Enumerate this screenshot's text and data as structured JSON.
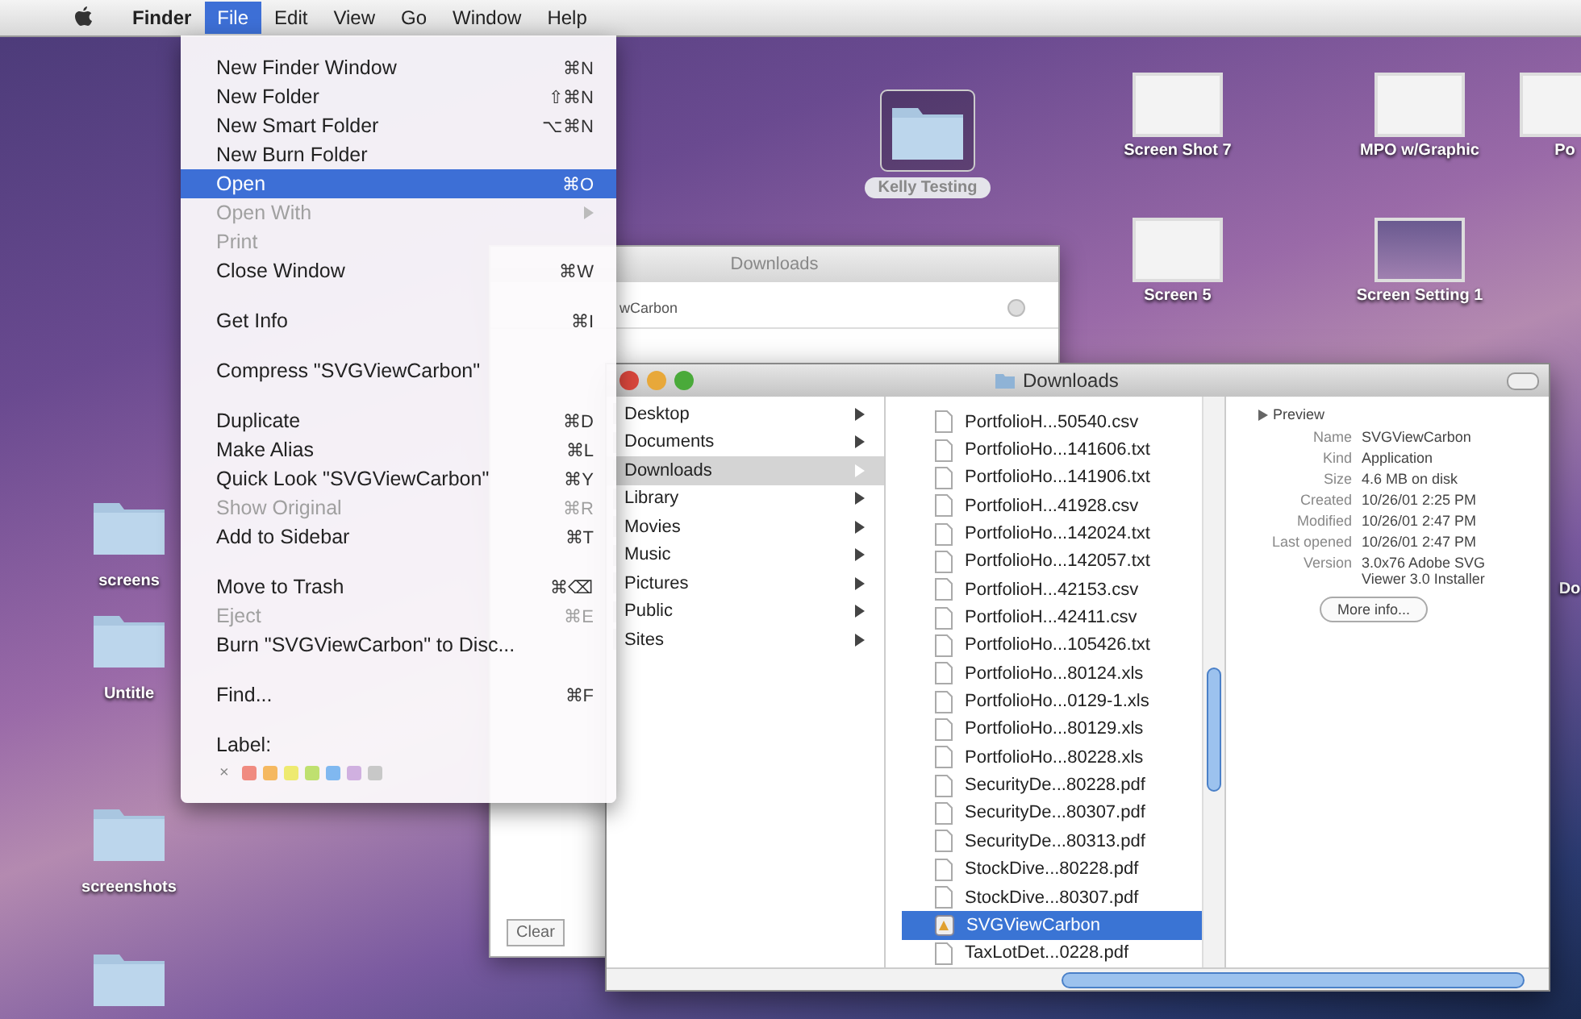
{
  "menu_bar": {
    "items": [
      {
        "label": "Finder",
        "selected": false
      },
      {
        "label": "File",
        "selected": true
      },
      {
        "label": "Edit",
        "selected": false
      },
      {
        "label": "View",
        "selected": false
      },
      {
        "label": "Go",
        "selected": false
      },
      {
        "label": "Window",
        "selected": false
      },
      {
        "label": "Help",
        "selected": false
      }
    ]
  },
  "desktop_icons": [
    {
      "label": "Kelly Testing",
      "kind": "folder",
      "selected": true
    },
    {
      "label": "Screen Shot 7",
      "kind": "screenshot",
      "selected": false
    },
    {
      "label": "MPO w/Graphic",
      "kind": "screenshot",
      "selected": false
    },
    {
      "label": "Po",
      "kind": "screenshot",
      "selected": false
    },
    {
      "label": "Screen 5",
      "kind": "screenshot",
      "selected": false
    },
    {
      "label": "Screen Setting 1",
      "kind": "photo",
      "selected": false
    },
    {
      "label": "Do"
    },
    {
      "label": "screens",
      "kind": "folder",
      "selected": false
    },
    {
      "label": "Untitle",
      "kind": "folder",
      "selected": false
    },
    {
      "label": "screenshots",
      "kind": "folder",
      "selected": false
    },
    {
      "kind": "folder",
      "selected": false
    }
  ],
  "back_window": {
    "title": "Downloads",
    "item": "wCarbon",
    "button": "Clear"
  },
  "file_menu": {
    "sections": [
      {
        "items": [
          {
            "label": "New Finder Window",
            "shortcut": "⌘N",
            "disabled": false,
            "selected": false
          },
          {
            "label": "New Folder",
            "shortcut": "⇧⌘N",
            "disabled": false,
            "selected": false
          },
          {
            "label": "New Smart Folder",
            "shortcut": "⌥⌘N",
            "disabled": false,
            "selected": false
          },
          {
            "label": "New Burn Folder",
            "disabled": false,
            "selected": false
          },
          {
            "label": "Open",
            "shortcut": "⌘O",
            "disabled": false,
            "selected": true
          },
          {
            "label": "Open With",
            "disabled": true,
            "selected": false,
            "submenu": true
          },
          {
            "label": "Print",
            "disabled": true,
            "selected": false
          },
          {
            "label": "Close Window",
            "shortcut": "⌘W",
            "disabled": false,
            "selected": false
          }
        ]
      },
      {
        "items": [
          {
            "label": "Get Info",
            "shortcut": "⌘I",
            "disabled": false,
            "selected": false
          }
        ]
      },
      {
        "items": [
          {
            "label": "Compress \"SVGViewCarbon\"",
            "disabled": false,
            "selected": false
          }
        ]
      },
      {
        "items": [
          {
            "label": "Duplicate",
            "shortcut": "⌘D",
            "disabled": false,
            "selected": false
          },
          {
            "label": "Make Alias",
            "shortcut": "⌘L",
            "disabled": false,
            "selected": false
          },
          {
            "label": "Quick Look \"SVGViewCarbon\"",
            "shortcut": "⌘Y",
            "disabled": false,
            "selected": false
          },
          {
            "label": "Show Original",
            "shortcut": "⌘R",
            "disabled": true,
            "selected": false
          },
          {
            "label": "Add to Sidebar",
            "shortcut": "⌘T",
            "disabled": false,
            "selected": false
          }
        ]
      },
      {
        "items": [
          {
            "label": "Move to Trash",
            "shortcut": "⌘⌫",
            "disabled": false,
            "selected": false
          },
          {
            "label": "Eject",
            "shortcut": "⌘E",
            "disabled": true,
            "selected": false
          },
          {
            "label": "Burn \"SVGViewCarbon\" to Disc...",
            "disabled": false,
            "selected": false
          }
        ]
      },
      {
        "items": [
          {
            "label": "Find...",
            "shortcut": "⌘F",
            "disabled": false,
            "selected": false
          }
        ]
      },
      {
        "items": [
          {
            "label": "Label:",
            "disabled": false,
            "selected": false
          }
        ]
      }
    ],
    "label_none": "×",
    "label_colors": [
      {
        "color": "#f08a80"
      },
      {
        "color": "#f5b860"
      },
      {
        "color": "#eeea70"
      },
      {
        "color": "#bfe070"
      },
      {
        "color": "#80b8f0"
      },
      {
        "color": "#d0b0e0"
      },
      {
        "color": "#c8c8c8"
      }
    ]
  },
  "finder_window": {
    "title": "Downloads",
    "places": [
      {
        "label": "Desktop",
        "selected": false
      },
      {
        "label": "Documents",
        "selected": false
      },
      {
        "label": "Downloads",
        "selected": true
      },
      {
        "label": "Library",
        "selected": false
      },
      {
        "label": "Movies",
        "selected": false
      },
      {
        "label": "Music",
        "selected": false
      },
      {
        "label": "Pictures",
        "selected": false
      },
      {
        "label": "Public",
        "selected": false
      },
      {
        "label": "Sites",
        "selected": false
      }
    ],
    "files": [
      {
        "name": "PortfolioH...50540.csv",
        "kind": "document",
        "selected": false
      },
      {
        "name": "PortfolioHo...141606.txt",
        "kind": "document",
        "selected": false
      },
      {
        "name": "PortfolioHo...141906.txt",
        "kind": "document",
        "selected": false
      },
      {
        "name": "PortfolioH...41928.csv",
        "kind": "document",
        "selected": false
      },
      {
        "name": "PortfolioHo...142024.txt",
        "kind": "document",
        "selected": false
      },
      {
        "name": "PortfolioHo...142057.txt",
        "kind": "document",
        "selected": false
      },
      {
        "name": "PortfolioH...42153.csv",
        "kind": "document",
        "selected": false
      },
      {
        "name": "PortfolioH...42411.csv",
        "kind": "document",
        "selected": false
      },
      {
        "name": "PortfolioHo...105426.txt",
        "kind": "document",
        "selected": false
      },
      {
        "name": "PortfolioHo...80124.xls",
        "kind": "document",
        "selected": false
      },
      {
        "name": "PortfolioHo...0129-1.xls",
        "kind": "document",
        "selected": false
      },
      {
        "name": "PortfolioHo...80129.xls",
        "kind": "document",
        "selected": false
      },
      {
        "name": "PortfolioHo...80228.xls",
        "kind": "document",
        "selected": false
      },
      {
        "name": "SecurityDe...80228.pdf",
        "kind": "document",
        "selected": false
      },
      {
        "name": "SecurityDe...80307.pdf",
        "kind": "document",
        "selected": false
      },
      {
        "name": "SecurityDe...80313.pdf",
        "kind": "document",
        "selected": false
      },
      {
        "name": "StockDive...80228.pdf",
        "kind": "document",
        "selected": false
      },
      {
        "name": "StockDive...80307.pdf",
        "kind": "document",
        "selected": false
      },
      {
        "name": "SVGViewCarbon",
        "kind": "application",
        "selected": true
      },
      {
        "name": "TaxLotDet...0228.pdf",
        "kind": "document",
        "selected": false
      }
    ],
    "preview": {
      "heading": "Preview",
      "fields": [
        {
          "label": "Name",
          "value": "SVGViewCarbon"
        },
        {
          "label": "Kind",
          "value": "Application"
        },
        {
          "label": "Size",
          "value": "4.6 MB on disk"
        },
        {
          "label": "Created",
          "value": "10/26/01 2:25 PM"
        },
        {
          "label": "Modified",
          "value": "10/26/01 2:47 PM"
        },
        {
          "label": "Last opened",
          "value": "10/26/01 2:47 PM"
        },
        {
          "label": "Version",
          "value": "3.0x76 Adobe SVG Viewer 3.0 Installer"
        }
      ],
      "button": "More info..."
    }
  }
}
